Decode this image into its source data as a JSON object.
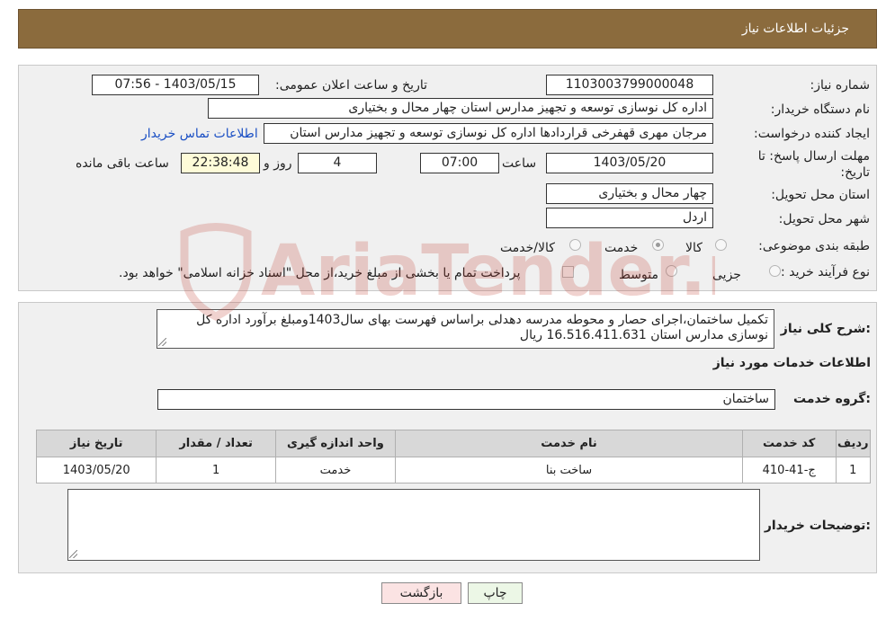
{
  "header": {
    "title": "جزئیات اطلاعات نیاز"
  },
  "form": {
    "need_number": {
      "label": "شماره نیاز:",
      "value": "1103003799000048"
    },
    "announce_datetime": {
      "label": "تاریخ و ساعت اعلان عمومی:",
      "value": "1403/05/15 - 07:56"
    },
    "buyer_org": {
      "label": "نام دستگاه خریدار:",
      "value": "اداره کل نوسازی  توسعه و تجهیز مدارس استان چهار محال و بختیاری"
    },
    "requester": {
      "label": "ایجاد کننده درخواست:",
      "value": "مرجان مهری قهفرخی قراردادها اداره کل نوسازی  توسعه و تجهیز مدارس استان",
      "contact_link": "اطلاعات تماس خریدار"
    },
    "deadline": {
      "label_line1": "مهلت ارسال پاسخ: تا",
      "label_line2": "تاریخ:",
      "date": "1403/05/20",
      "time_label": "ساعت",
      "time": "07:00",
      "days": "4",
      "days_label": "روز و",
      "remaining": "22:38:48",
      "remaining_label": "ساعت باقی مانده"
    },
    "delivery_province": {
      "label": "استان محل تحویل:",
      "value": "چهار محال و بختیاری"
    },
    "delivery_city": {
      "label": "شهر محل تحویل:",
      "value": "اردل"
    },
    "category": {
      "label": "طبقه بندی موضوعی:",
      "options": [
        "کالا",
        "خدمت",
        "کالا/خدمت"
      ],
      "selected": "خدمت"
    },
    "purchase_process": {
      "label": "نوع فرآیند خرید :",
      "options": [
        "جزیی",
        "متوسط"
      ],
      "note": "پرداخت تمام یا بخشی از مبلغ خرید،از محل \"اسناد خزانه اسلامی\" خواهد بود."
    }
  },
  "description": {
    "label": "شرح کلی نیاز:",
    "text": "تکمیل ساختمان،اجرای حصار و محوطه مدرسه دهدلی براساس فهرست بهای سال1403ومبلغ برآورد اداره کل نوسازی مدارس استان 16.516.411.631 ریال"
  },
  "services": {
    "section_title": "اطلاعات خدمات مورد نیاز",
    "group_label": "گروه خدمت:",
    "group_value": "ساختمان",
    "columns": [
      "ردیف",
      "کد خدمت",
      "نام خدمت",
      "واحد اندازه گیری",
      "تعداد / مقدار",
      "تاریخ نیاز"
    ],
    "rows": [
      [
        "1",
        "ج-41-410",
        "ساخت بنا",
        "خدمت",
        "1",
        "1403/05/20"
      ]
    ]
  },
  "buyer_notes": {
    "label": "توضیحات خریدار:",
    "value": ""
  },
  "buttons": {
    "print": "چاپ",
    "back": "بازگشت"
  },
  "watermark": {
    "text": "AriaTender.neT",
    "color": "#c0392b"
  }
}
